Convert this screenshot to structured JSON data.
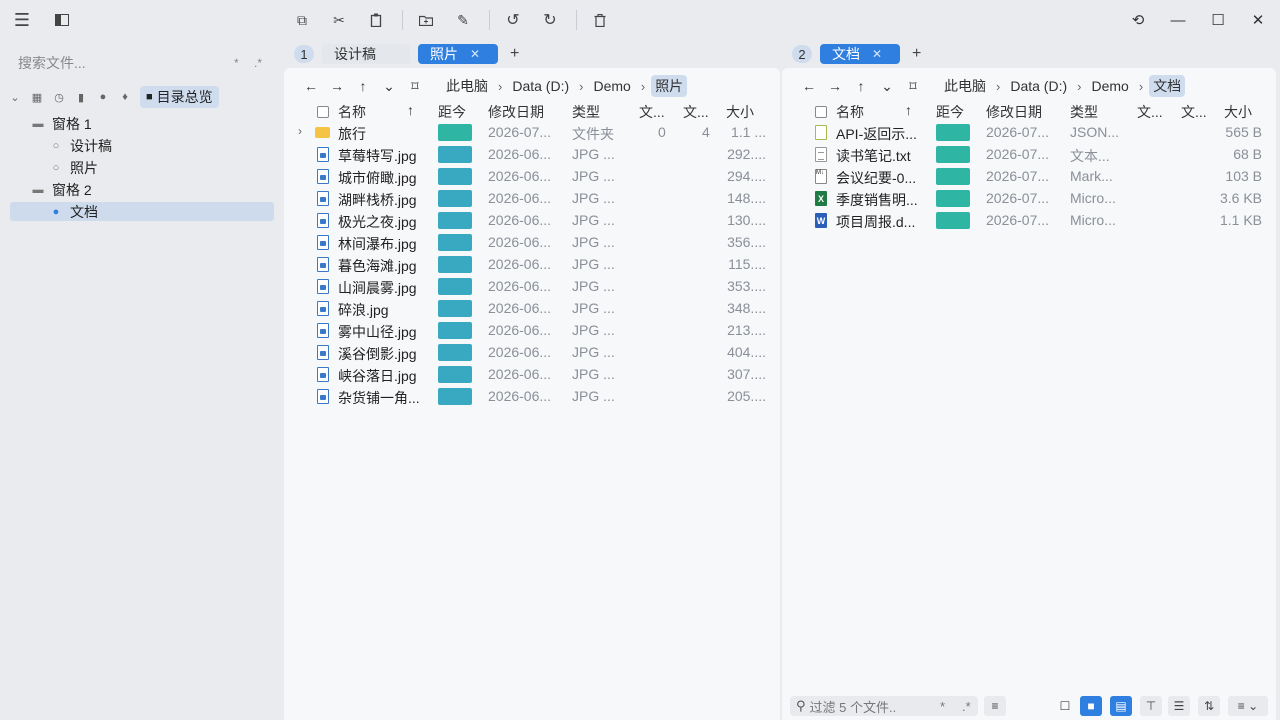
{
  "toolbar": {
    "icons": [
      "hamburger-icon",
      "sidebar-toggle-icon",
      "copy-icon",
      "cut-icon",
      "paste-icon",
      "new-folder-icon",
      "rename-icon",
      "undo-icon",
      "redo-icon",
      "delete-icon",
      "history-icon"
    ]
  },
  "sidebar": {
    "search_placeholder": "搜索文件...",
    "search_mod1": "*",
    "search_mod2": ".*",
    "overview_label": "目录总览",
    "tree": [
      {
        "label": "窗格 1",
        "level": 0
      },
      {
        "label": "设计稿",
        "level": 1
      },
      {
        "label": "照片",
        "level": 1
      },
      {
        "label": "窗格 2",
        "level": 0
      },
      {
        "label": "文档",
        "level": 1,
        "selected": true
      }
    ]
  },
  "left_pane": {
    "number": "1",
    "tabs": [
      {
        "label": "设计稿",
        "active": false
      },
      {
        "label": "照片",
        "active": true
      }
    ],
    "breadcrumbs": [
      "此电脑",
      "Data (D:)",
      "Demo",
      "照片"
    ],
    "columns": {
      "name": "名称",
      "age": "距今",
      "modified": "修改日期",
      "type": "类型",
      "c1": "文...",
      "c2": "文...",
      "size": "大小"
    },
    "rows": [
      {
        "name": "旅行",
        "modified": "2026-07...",
        "type": "文件夹",
        "c1": "0",
        "c2": "4",
        "size": "1.1 ...",
        "kind": "folder",
        "bar": "#2fb5a3"
      },
      {
        "name": "草莓特写.jpg",
        "modified": "2026-06...",
        "type": "JPG ...",
        "size": "292....",
        "kind": "img",
        "bar": "#39a9c2"
      },
      {
        "name": "城市俯瞰.jpg",
        "modified": "2026-06...",
        "type": "JPG ...",
        "size": "294....",
        "kind": "img",
        "bar": "#39a9c2"
      },
      {
        "name": "湖畔栈桥.jpg",
        "modified": "2026-06...",
        "type": "JPG ...",
        "size": "148....",
        "kind": "img",
        "bar": "#39a9c2"
      },
      {
        "name": "极光之夜.jpg",
        "modified": "2026-06...",
        "type": "JPG ...",
        "size": "130....",
        "kind": "img",
        "bar": "#39a9c2"
      },
      {
        "name": "林间瀑布.jpg",
        "modified": "2026-06...",
        "type": "JPG ...",
        "size": "356....",
        "kind": "img",
        "bar": "#39a9c2"
      },
      {
        "name": "暮色海滩.jpg",
        "modified": "2026-06...",
        "type": "JPG ...",
        "size": "115....",
        "kind": "img",
        "bar": "#39a9c2"
      },
      {
        "name": "山涧晨雾.jpg",
        "modified": "2026-06...",
        "type": "JPG ...",
        "size": "353....",
        "kind": "img",
        "bar": "#39a9c2"
      },
      {
        "name": "碎浪.jpg",
        "modified": "2026-06...",
        "type": "JPG ...",
        "size": "348....",
        "kind": "img",
        "bar": "#39a9c2"
      },
      {
        "name": "雾中山径.jpg",
        "modified": "2026-06...",
        "type": "JPG ...",
        "size": "213....",
        "kind": "img",
        "bar": "#39a9c2"
      },
      {
        "name": "溪谷倒影.jpg",
        "modified": "2026-06...",
        "type": "JPG ...",
        "size": "404....",
        "kind": "img",
        "bar": "#39a9c2"
      },
      {
        "name": "峡谷落日.jpg",
        "modified": "2026-06...",
        "type": "JPG ...",
        "size": "307....",
        "kind": "img",
        "bar": "#39a9c2"
      },
      {
        "name": "杂货铺一角...",
        "modified": "2026-06...",
        "type": "JPG ...",
        "size": "205....",
        "kind": "img",
        "bar": "#39a9c2"
      }
    ]
  },
  "right_pane": {
    "number": "2",
    "tabs": [
      {
        "label": "文档",
        "active": true
      }
    ],
    "breadcrumbs": [
      "此电脑",
      "Data (D:)",
      "Demo",
      "文档"
    ],
    "columns": {
      "name": "名称",
      "age": "距今",
      "modified": "修改日期",
      "type": "类型",
      "c1": "文...",
      "c2": "文...",
      "size": "大小"
    },
    "rows": [
      {
        "name": "API-返回示...",
        "modified": "2026-07...",
        "type": "JSON...",
        "size": "565 B",
        "kind": "json",
        "bar": "#2fb5a3"
      },
      {
        "name": "读书笔记.txt",
        "modified": "2026-07...",
        "type": "文本...",
        "size": "68 B",
        "kind": "txt",
        "bar": "#2fb5a3"
      },
      {
        "name": "会议纪要-0...",
        "modified": "2026-07...",
        "type": "Mark...",
        "size": "103 B",
        "kind": "md",
        "bar": "#2fb5a3"
      },
      {
        "name": "季度销售明...",
        "modified": "2026-07...",
        "type": "Micro...",
        "size": "3.6 KB",
        "kind": "xls",
        "bar": "#2fb5a3"
      },
      {
        "name": "项目周报.d...",
        "modified": "2026-07...",
        "type": "Micro...",
        "size": "1.1 KB",
        "kind": "doc",
        "bar": "#2fb5a3"
      }
    ],
    "filter_placeholder": "过滤 5 个文件..",
    "filter_mod1": "*",
    "filter_mod2": ".*"
  },
  "colors": {
    "accent": "#2f7fe0",
    "selection": "#cddbed"
  }
}
